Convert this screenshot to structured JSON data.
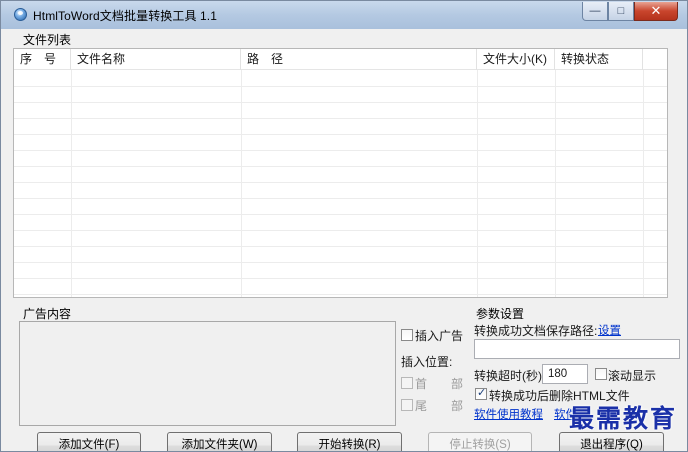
{
  "window": {
    "title": "HtmlToWord文档批量转换工具 1.1",
    "caption": {
      "minimize": "—",
      "maximize": "□",
      "close": "✕"
    }
  },
  "file_list": {
    "group_label": "文件列表",
    "columns": [
      "序　号",
      "文件名称",
      "路　径",
      "文件大小(K)",
      "转换状态"
    ],
    "rows": []
  },
  "ad": {
    "group_label": "广告内容",
    "insert_ad_label": "插入广告",
    "insert_position_label": "插入位置:",
    "position_head_label": "首　　部",
    "position_tail_label": "尾　　部"
  },
  "params": {
    "group_label": "参数设置",
    "save_path_label": "转换成功文档保存路径:",
    "set_link": "设置",
    "save_path_value": "",
    "timeout_label": "转换超时(秒):",
    "timeout_value": "180",
    "scroll_display_label": "滚动显示",
    "delete_html_label": "转换成功后删除HTML文件",
    "tutorial_link": "软件使用教程",
    "other_link": "软件"
  },
  "buttons": {
    "add_file": "添加文件(F)",
    "add_folder": "添加文件夹(W)",
    "start": "开始转换(R)",
    "stop": "停止转换(S)",
    "exit": "退出程序(Q)"
  },
  "watermark": "最需教育",
  "colors": {
    "accent_link": "#0033cc",
    "watermark": "#1a30a8",
    "close_button": "#c9452d"
  }
}
